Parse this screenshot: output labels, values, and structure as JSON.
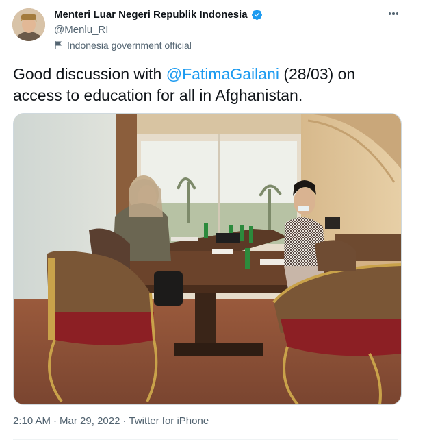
{
  "author": {
    "name": "Menteri Luar Negeri Republik Indonesia",
    "handle": "@Menlu_RI",
    "label": "Indonesia government official",
    "verified_icon": "verified-badge-icon"
  },
  "tweet": {
    "text_before": "Good discussion with ",
    "mention": "@FatimaGailani",
    "text_after": " (28/03) on access to education for all in Afghanistan."
  },
  "meta": {
    "time": "2:10 AM",
    "separator1": "·",
    "date": "Mar 29, 2022",
    "separator2": "·",
    "source": "Twitter for iPhone"
  },
  "colors": {
    "accent": "#1d9bf0",
    "text": "#0f1419",
    "secondary": "#536471"
  }
}
